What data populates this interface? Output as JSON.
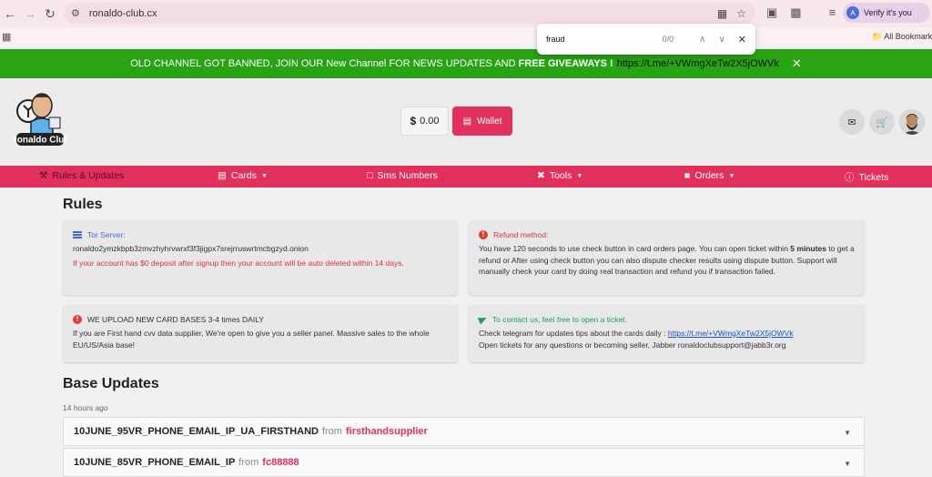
{
  "browser": {
    "url": "ronaldo-club.cx",
    "verify_label": "Verify it's you",
    "bookmarks_label": "All Bookmarks",
    "find": {
      "query": "fraud",
      "count": "0/0"
    }
  },
  "announcement": {
    "text_part1": "OLD CHANNEL GOT BANNED, JOIN OUR New Channel FOR NEWS UPDATES AND ",
    "text_bold": "FREE GIVEAWAYS !",
    "link": "https://t.me/+VWmgXeTw2X5jOWVk"
  },
  "header": {
    "logo_text": "Ronaldo Club",
    "balance_currency": "$",
    "balance_value": "0.00",
    "wallet_label": "Wallet"
  },
  "nav": {
    "rules": "Rules & Updates",
    "cards": "Cards",
    "sms": "Sms Numbers",
    "tools": "Tools",
    "orders": "Orders",
    "tickets": "Tickets"
  },
  "rules": {
    "title": "Rules",
    "tor": {
      "label": "Tor Server:",
      "address": "ronaldo2ymzkbpb3zmvzhyhrvwrxf3f3jigpx7srejrruswrtmcbgzyd.onion",
      "warning": "If your account has $0 deposit after signup then your account will be auto deleted within 14 days."
    },
    "refund": {
      "label": "Refund method:",
      "text1": "You have 120 seconds to use check button in card orders page. You can open ticket within ",
      "text_bold": "5 minutes",
      "text2": " to get a refund or After using check button you can also dispute checker results using dispute button. Support will manually check your card by doing real transaction and refund you if transaction failed."
    },
    "bases": {
      "label": "WE UPLOAD NEW CARD BASES 3-4 times DAILY",
      "text": "If you are First hand cvv data supplier, We're open to give you a seller panel. Massive sales to the whole EU/US/Asia base!"
    },
    "contact": {
      "label": "To contact us, feel free to open a ticket.",
      "text1": "Check telegram for updates tips about the cards daily : ",
      "link": "https://t.me/+VWmgXeTw2X5jOWVk",
      "text2": "Open tickets for any questions or becoming seller, Jabber ronaldoclubsupport@jabb3r.org"
    }
  },
  "base_updates": {
    "title": "Base Updates",
    "time_ago": "14 hours ago",
    "from_word": "from",
    "items": [
      {
        "name": "10JUNE_95VR_PHONE_EMAIL_IP_UA_FIRSTHAND",
        "seller": "firsthandsupplier"
      },
      {
        "name": "10JUNE_85VR_PHONE_EMAIL_IP",
        "seller": "fc88888"
      }
    ]
  }
}
